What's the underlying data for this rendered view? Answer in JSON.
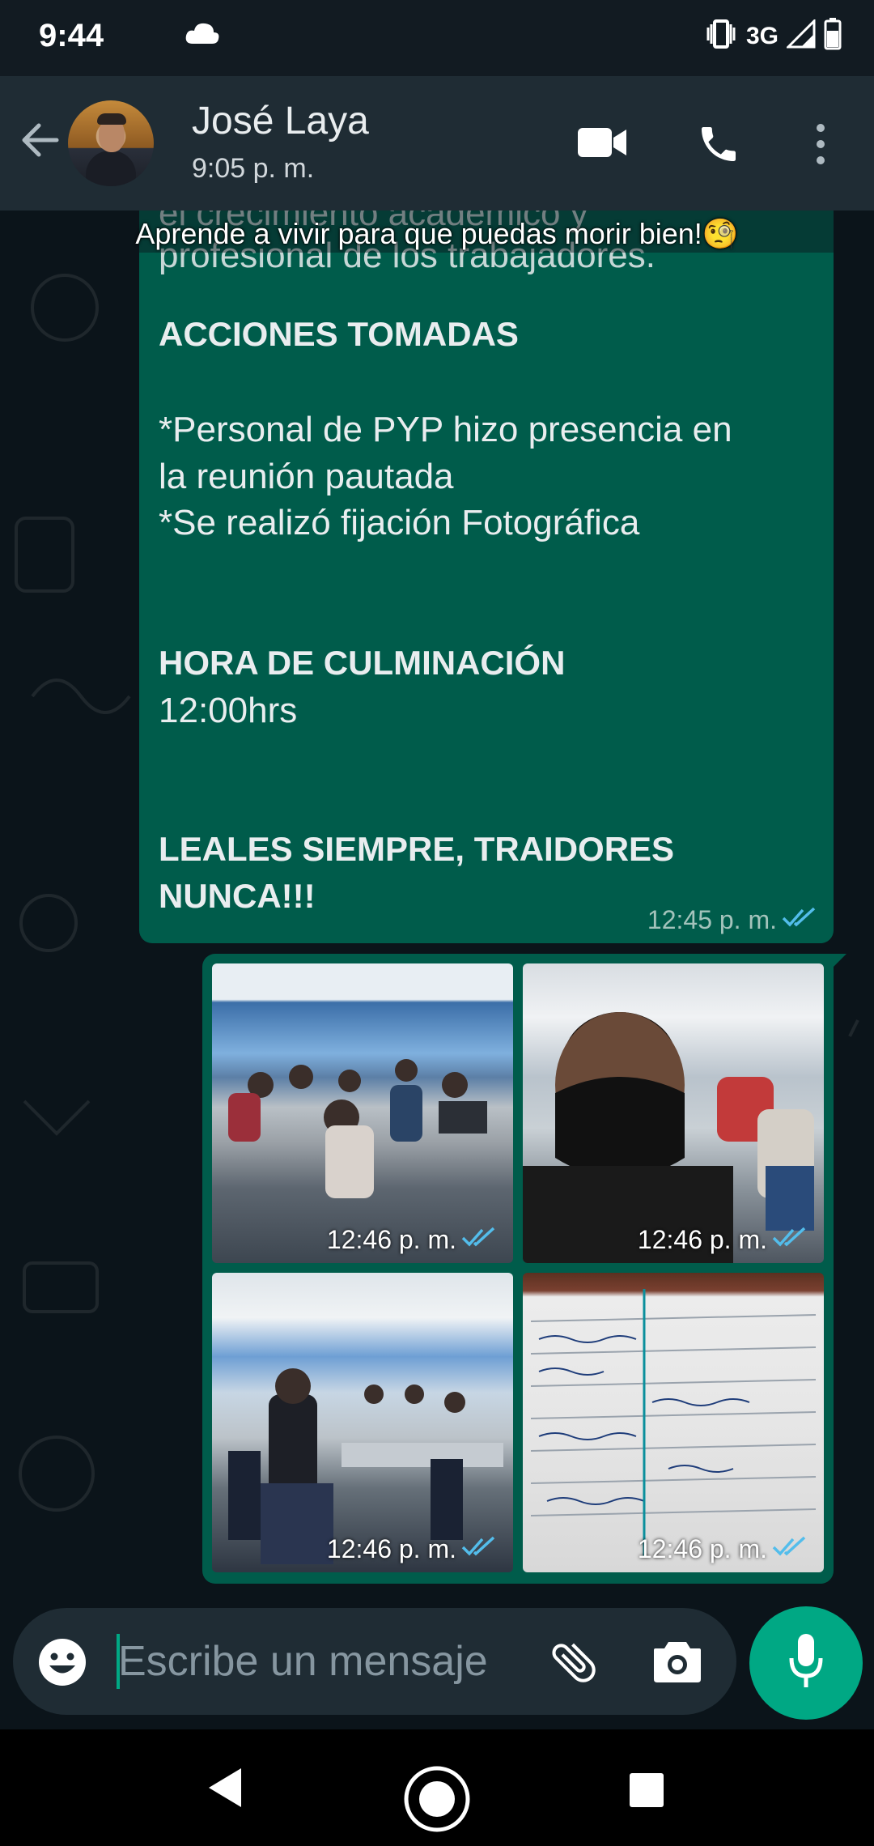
{
  "status_bar": {
    "time": "9:44",
    "network": "3G"
  },
  "header": {
    "contact_name": "José Laya",
    "last_seen": "9:05 p. m."
  },
  "chat": {
    "banner": "Aprende a vivir para que puedas morir bien!🧐",
    "text_message": {
      "cut_off_lines": [
        "el crecimiento académico y",
        "profesional de los trabajadores."
      ],
      "lines": [
        "ACCIONES TOMADAS",
        "*Personal de PYP hizo presencia en",
        "la reunión pautada",
        "*Se realizó fijación Fotográfica",
        "HORA DE CULMINACIÓN",
        "12:00hrs",
        "LEALES SIEMPRE, TRAIDORES",
        "NUNCA!!!"
      ],
      "time": "12:45 p. m."
    },
    "photos": [
      {
        "time": "12:46 p. m."
      },
      {
        "time": "12:46 p. m."
      },
      {
        "time": "12:46 p. m."
      },
      {
        "time": "12:46 p. m."
      }
    ]
  },
  "input": {
    "placeholder": "Escribe un mensaje"
  },
  "colors": {
    "header_bg": "#1f2c34",
    "bubble_out": "#005c4b",
    "accent": "#00a884",
    "read_tick": "#53bdeb"
  }
}
